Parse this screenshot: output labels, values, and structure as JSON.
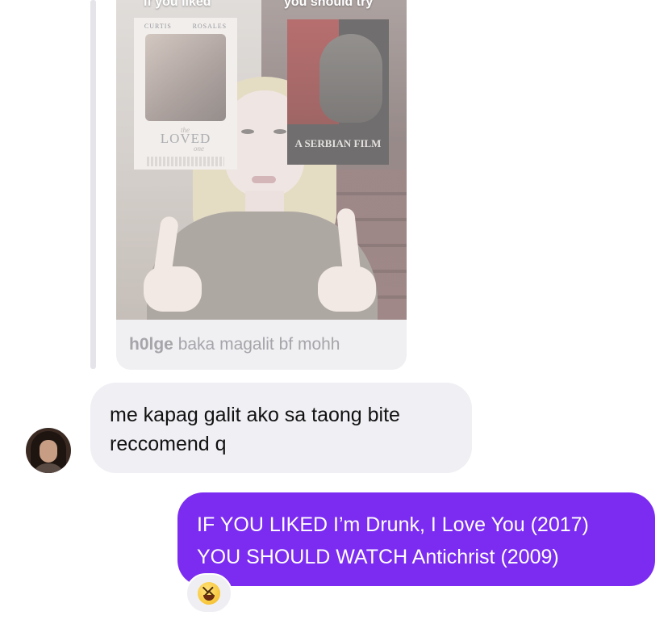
{
  "shared_post": {
    "caption_left": "if you liked",
    "caption_right": "you should try",
    "poster_left": {
      "actor_left": "CURTIS",
      "actor_right": "ROSALES",
      "title_prefix": "the",
      "title": "LOVED",
      "title_suffix": "one"
    },
    "poster_right": {
      "title": "A SERBIAN FILM"
    },
    "username": "h0lge",
    "caption_text": "baka magalit bf mohh"
  },
  "messages": [
    {
      "direction": "received",
      "text": "me kapag galit ako sa taong bite reccomend q"
    },
    {
      "direction": "sent",
      "line1": "IF YOU LIKED I’m Drunk, I Love You (2017)",
      "line2": "YOU SHOULD WATCH Antichrist (2009)"
    }
  ],
  "reaction": {
    "icon": "laughing-squinting-face-icon"
  },
  "colors": {
    "sent_bubble": "#7b2cf0",
    "received_bubble": "#efeff4",
    "muted_text": "#a5a5aa"
  }
}
